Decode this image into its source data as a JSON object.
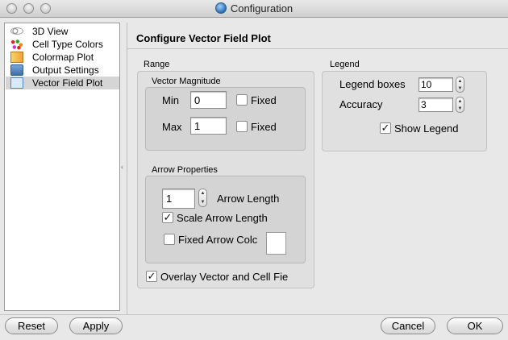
{
  "window": {
    "title": "Configuration"
  },
  "sidebar": {
    "items": [
      {
        "label": "3D View",
        "icon": "3d-view-icon",
        "selected": false
      },
      {
        "label": "Cell Type Colors",
        "icon": "cell-colors-icon",
        "selected": false
      },
      {
        "label": "Colormap Plot",
        "icon": "colormap-icon",
        "selected": false
      },
      {
        "label": "Output Settings",
        "icon": "output-settings-icon",
        "selected": false
      },
      {
        "label": "Vector Field Plot",
        "icon": "vector-field-icon",
        "selected": true
      }
    ]
  },
  "panel": {
    "title": "Configure Vector Field Plot",
    "range": {
      "label": "Range",
      "vector_magnitude": {
        "label": "Vector Magnitude",
        "min_label": "Min",
        "min_value": "0",
        "min_fixed_label": "Fixed",
        "min_fixed": false,
        "max_label": "Max",
        "max_value": "1",
        "max_fixed_label": "Fixed",
        "max_fixed": false
      },
      "arrow_properties": {
        "label": "Arrow Properties",
        "arrow_length_value": "1",
        "arrow_length_label": "Arrow Length",
        "scale_arrow_label": "Scale Arrow Length",
        "scale_arrow": true,
        "fixed_color_label": "Fixed Arrow Colc",
        "fixed_color": false
      },
      "overlay_label": "Overlay Vector and Cell Fie",
      "overlay": true
    },
    "legend": {
      "label": "Legend",
      "boxes_label": "Legend boxes",
      "boxes_value": "10",
      "accuracy_label": "Accuracy",
      "accuracy_value": "3",
      "show_label": "Show Legend",
      "show": true
    }
  },
  "buttons": {
    "reset": "Reset",
    "apply": "Apply",
    "cancel": "Cancel",
    "ok": "OK"
  }
}
